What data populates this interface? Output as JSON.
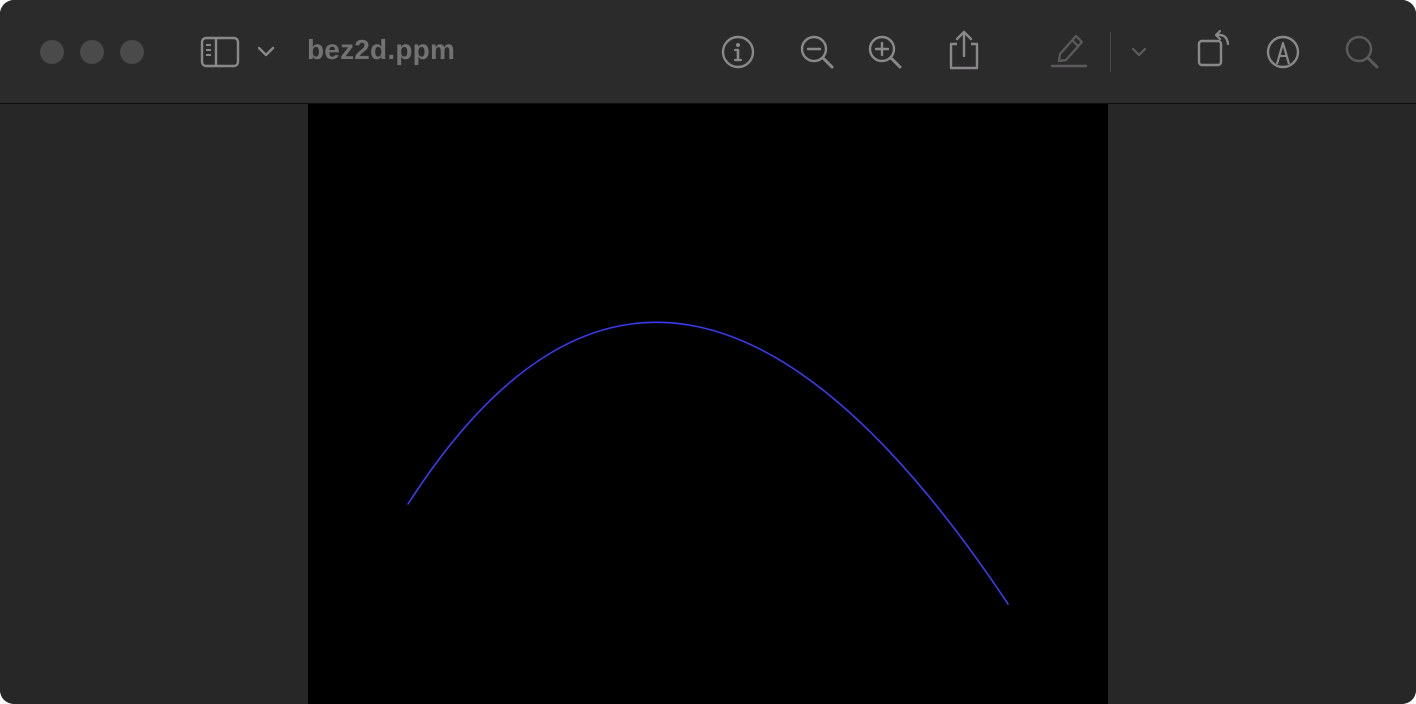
{
  "window": {
    "title": "bez2d.ppm"
  },
  "toolbar": {
    "icons": [
      "sidebar-icon",
      "chevron-down-icon",
      "info-icon",
      "zoom-out-icon",
      "zoom-in-icon",
      "share-icon",
      "highlight-pen-icon",
      "chevron-down-icon",
      "rotate-icon",
      "markup-icon",
      "search-icon"
    ]
  },
  "image": {
    "background_color": "#000000",
    "curve_color": "#3a3cf0"
  }
}
